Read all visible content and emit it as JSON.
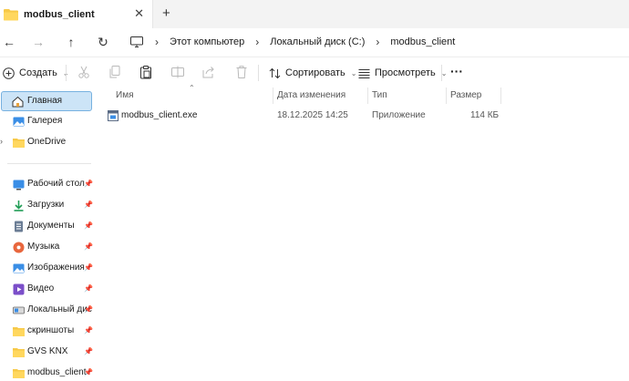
{
  "tab": {
    "title": "modbus_client",
    "close_glyph": "✕",
    "new_tab_glyph": "+"
  },
  "nav": {
    "back_glyph": "←",
    "forward_glyph": "→",
    "up_glyph": "↑",
    "refresh_glyph": "↻",
    "breadcrumbs": [
      "Этот компьютер",
      "Локальный диск (C:)",
      "modbus_client"
    ],
    "separator": "›"
  },
  "toolbar": {
    "new_label": "Создать",
    "sort_label": "Сортировать",
    "view_label": "Просмотреть",
    "more_glyph": "···"
  },
  "sidebar": {
    "items": [
      {
        "label": "Главная",
        "icon": "home-icon",
        "selected": true
      },
      {
        "label": "Галерея",
        "icon": "gallery-icon"
      },
      {
        "label": "OneDrive",
        "icon": "folder-icon"
      },
      {
        "label": "Рабочий стол",
        "icon": "desktop-icon",
        "pinned": true
      },
      {
        "label": "Загрузки",
        "icon": "download-icon",
        "pinned": true
      },
      {
        "label": "Документы",
        "icon": "documents-icon",
        "pinned": true
      },
      {
        "label": "Музыка",
        "icon": "music-icon",
        "pinned": true
      },
      {
        "label": "Изображения",
        "icon": "pictures-icon",
        "pinned": true
      },
      {
        "label": "Видео",
        "icon": "video-icon",
        "pinned": true
      },
      {
        "label": "Локальный дис",
        "icon": "drive-icon",
        "pinned": true
      },
      {
        "label": "скриншоты",
        "icon": "folder-icon",
        "pinned": true
      },
      {
        "label": "GVS KNX",
        "icon": "folder-icon",
        "pinned": true
      },
      {
        "label": "modbus_client",
        "icon": "folder-icon",
        "pinned": true
      }
    ],
    "pin_glyph": "📌",
    "expand_glyph": "›"
  },
  "columns": {
    "name": "Имя",
    "date": "Дата изменения",
    "type": "Тип",
    "size": "Размер",
    "sort_glyph": "⌃"
  },
  "files": [
    {
      "name": "modbus_client.exe",
      "date": "18.12.2025 14:25",
      "type": "Приложение",
      "size": "114 КБ",
      "icon": "exe-icon"
    }
  ],
  "colors": {
    "accent": "#0067c0",
    "selection_bg": "#cce4f7",
    "folder_yellow": "#f7c948"
  }
}
